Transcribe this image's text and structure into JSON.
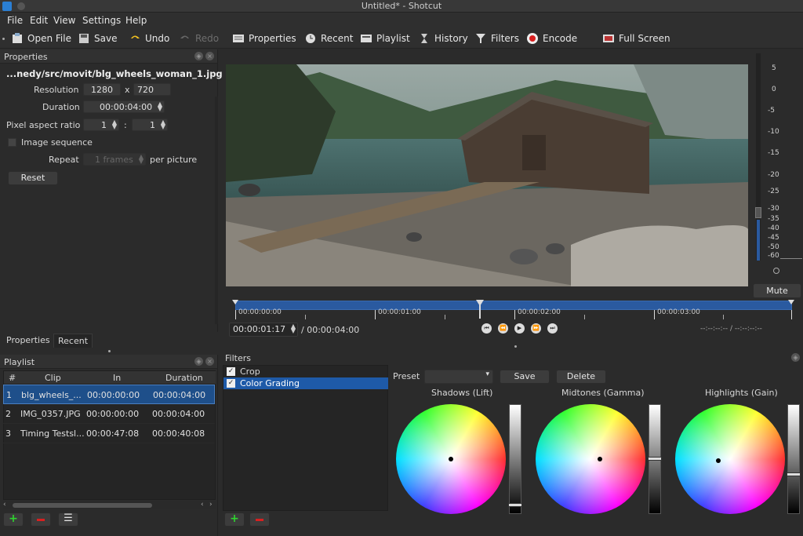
{
  "window": {
    "title": "Untitled* - Shotcut"
  },
  "menu": [
    "File",
    "Edit",
    "View",
    "Settings",
    "Help"
  ],
  "toolbar": {
    "open": "Open File",
    "save": "Save",
    "undo": "Undo",
    "redo": "Redo",
    "properties": "Properties",
    "recent": "Recent",
    "playlist": "Playlist",
    "history": "History",
    "filters": "Filters",
    "encode": "Encode",
    "fullscreen": "Full Screen"
  },
  "properties": {
    "title": "Properties",
    "filename": "...nedy/src/movit/blg_wheels_woman_1.jpg",
    "resolution_label": "Resolution",
    "width": "1280",
    "x_sep": "x",
    "height": "720",
    "duration_label": "Duration",
    "duration": "00:00:04:00",
    "par_label": "Pixel aspect ratio",
    "par_num": "1",
    "par_sep": ":",
    "par_den": "1",
    "imgseq_label": "Image sequence",
    "repeat_label": "Repeat",
    "repeat_value": "1 frames",
    "per_picture": "per picture",
    "reset": "Reset",
    "tabs": [
      "Properties",
      "Recent"
    ]
  },
  "playlist": {
    "title": "Playlist",
    "columns": [
      "#",
      "Clip",
      "In",
      "Duration"
    ],
    "rows": [
      {
        "num": "1",
        "clip": "blg_wheels_...",
        "in": "00:00:00:00",
        "duration": "00:00:04:00"
      },
      {
        "num": "2",
        "clip": "IMG_0357.JPG",
        "in": "00:00:00:00",
        "duration": "00:00:04:00"
      },
      {
        "num": "3",
        "clip": "Timing Testsl...",
        "in": "00:00:47:08",
        "duration": "00:00:40:08"
      }
    ]
  },
  "filters": {
    "title": "Filters",
    "items": [
      {
        "name": "Crop",
        "checked": true
      },
      {
        "name": "Color Grading",
        "checked": true
      }
    ],
    "preset_label": "Preset",
    "save": "Save",
    "delete": "Delete",
    "wheels": [
      {
        "label": "Shadows (Lift)",
        "level": 0.05
      },
      {
        "label": "Midtones (Gamma)",
        "level": 0.5
      },
      {
        "label": "Highlights (Gain)",
        "level": 0.35
      }
    ]
  },
  "player": {
    "timecodes": [
      "00:00:00:00",
      "00:00:01:00",
      "00:00:02:00",
      "00:00:03:00"
    ],
    "position": "00:00:01:17",
    "total": "/ 00:00:04:00",
    "in_out": "--:--:--:-- / --:--:--:--",
    "playhead_fraction": 0.44
  },
  "audio_meter": {
    "scale": [
      "5",
      "0",
      "-5",
      "-10",
      "-15",
      "-20",
      "-25",
      "-30",
      "-35",
      "-40",
      "-45",
      "-50",
      "-60"
    ],
    "mute": "Mute"
  },
  "colors": {
    "accent": "#2a5aa0",
    "selected": "#1e4f8a",
    "toolbar_bg": "#2f2f2f"
  }
}
